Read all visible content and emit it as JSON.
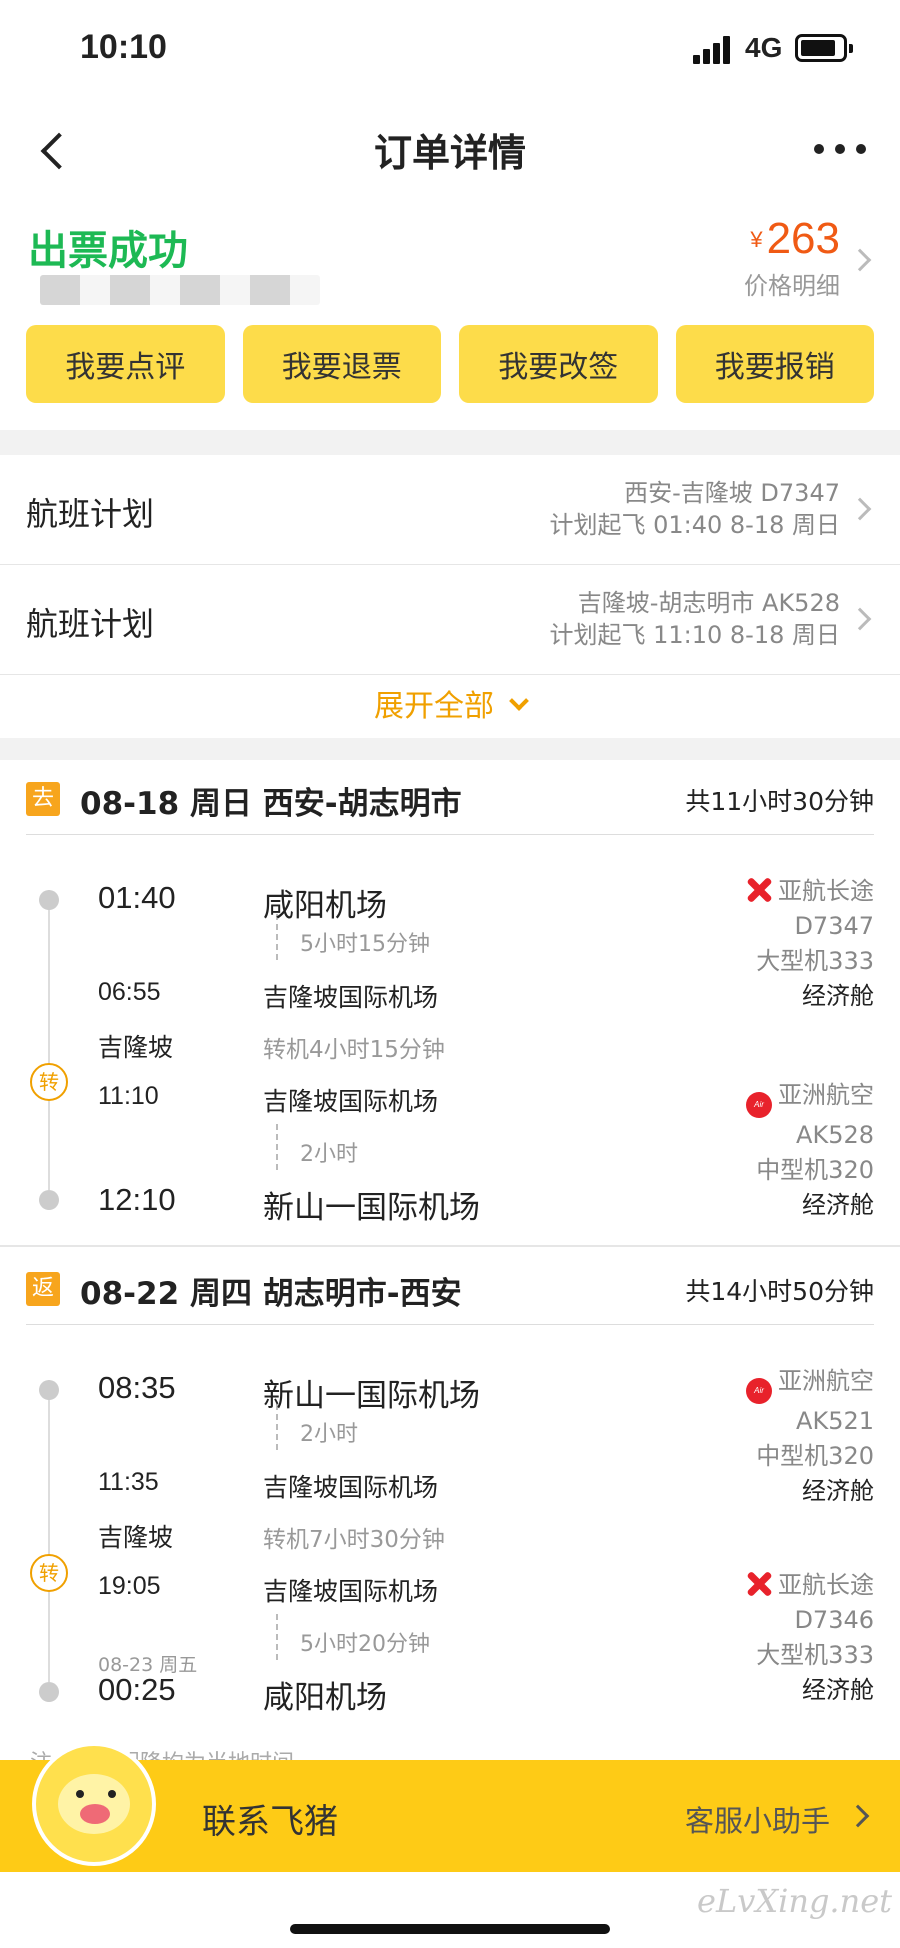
{
  "status_bar": {
    "time": "10:10",
    "network": "4G"
  },
  "nav": {
    "title": "订单详情"
  },
  "order": {
    "status": "出票成功",
    "currency": "¥",
    "price": "263",
    "price_detail": "价格明细",
    "actions": [
      "我要点评",
      "我要退票",
      "我要改签",
      "我要报销"
    ]
  },
  "plans": [
    {
      "label": "航班计划",
      "line1": "西安-吉隆坡 D7347",
      "line2": "计划起飞 01:40 8-18 周日"
    },
    {
      "label": "航班计划",
      "line1": "吉隆坡-胡志明市 AK528",
      "line2": "计划起飞 11:10 8-18 周日"
    }
  ],
  "expand_all": "展开全部",
  "outbound": {
    "tag": "去",
    "route": "08-18 周日 西安-胡志明市",
    "total": "共11小时30分钟",
    "leg1": {
      "dep_time": "01:40",
      "dep_airport": "咸阳机场",
      "duration": "5小时15分钟",
      "arr_time": "06:55",
      "arr_airport": "吉隆坡国际机场",
      "airline": "亚航长途",
      "flight": "D7347",
      "aircraft": "大型机333",
      "cabin": "经济舱"
    },
    "transfer": {
      "badge": "转",
      "city": "吉隆坡",
      "duration": "转机4小时15分钟"
    },
    "leg2": {
      "dep_time": "11:10",
      "dep_airport": "吉隆坡国际机场",
      "duration": "2小时",
      "arr_time": "12:10",
      "arr_airport": "新山一国际机场",
      "airline": "亚洲航空",
      "flight": "AK528",
      "aircraft": "中型机320",
      "cabin": "经济舱"
    }
  },
  "return": {
    "tag": "返",
    "route": "08-22 周四 胡志明市-西安",
    "total": "共14小时50分钟",
    "leg1": {
      "dep_time": "08:35",
      "dep_airport": "新山一国际机场",
      "duration": "2小时",
      "arr_time": "11:35",
      "arr_airport": "吉隆坡国际机场",
      "airline": "亚洲航空",
      "flight": "AK521",
      "aircraft": "中型机320",
      "cabin": "经济舱"
    },
    "transfer": {
      "badge": "转",
      "city": "吉隆坡",
      "duration": "转机7小时30分钟"
    },
    "leg2": {
      "dep_time": "19:05",
      "dep_airport": "吉隆坡国际机场",
      "duration": "5小时20分钟",
      "arr_date": "08-23 周五",
      "arr_time": "00:25",
      "arr_airport": "咸阳机场",
      "airline": "亚航长途",
      "flight": "D7346",
      "aircraft": "大型机333",
      "cabin": "经济舱"
    }
  },
  "footer_note": "注：航班起降均为当地时间",
  "bottom_bar": {
    "contact": "联系飞猪",
    "assistant": "客服小助手"
  },
  "watermark": "eLvXing.net",
  "colors": {
    "accent_yellow": "#fecb16",
    "button_yellow": "#fddc4a",
    "price_orange": "#f05a14",
    "success_green": "#1db954",
    "expand_orange": "#f0a000"
  }
}
